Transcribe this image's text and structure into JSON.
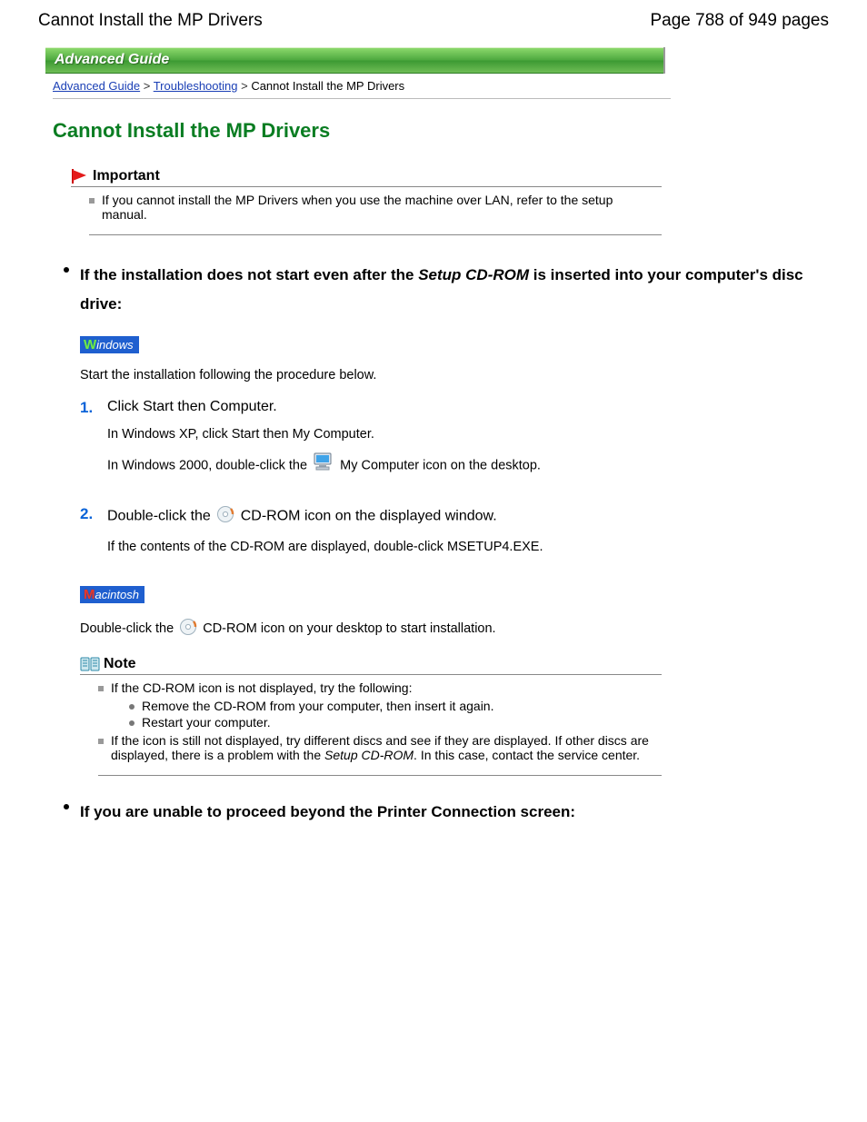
{
  "header": {
    "page_title_top": "Cannot Install the MP Drivers",
    "page_indicator": "Page 788 of 949 pages"
  },
  "banner": {
    "label": "Advanced Guide"
  },
  "breadcrumbs": {
    "link1": "Advanced Guide",
    "link2": "Troubleshooting",
    "current": "Cannot Install the MP Drivers"
  },
  "title": "Cannot Install the MP Drivers",
  "important": {
    "heading": "Important",
    "item1": "If you cannot install the MP Drivers when you use the machine over LAN, refer to the setup manual."
  },
  "section1": {
    "heading_before": "If the installation does not start even after the ",
    "heading_ital": "Setup CD-ROM",
    "heading_after": " is inserted into your computer's disc drive:",
    "windows_label": "indows",
    "intro": "Start the installation following the procedure below.",
    "step1": {
      "title": "Click Start then Computer.",
      "line1": "In Windows XP, click Start then My Computer.",
      "line2_before": "In Windows 2000, double-click the ",
      "line2_after": "My Computer icon on the desktop."
    },
    "step2": {
      "title_before": "Double-click the ",
      "title_after": " CD-ROM icon on the displayed window.",
      "line1": "If the contents of the CD-ROM are displayed, double-click MSETUP4.EXE."
    },
    "mac_label": "acintosh",
    "mac_line_before": "Double-click the ",
    "mac_line_after": " CD-ROM icon on your desktop to start installation."
  },
  "note": {
    "heading": "Note",
    "item1": "If the CD-ROM icon is not displayed, try the following:",
    "sub1": "Remove the CD-ROM from your computer, then insert it again.",
    "sub2": "Restart your computer.",
    "item2_before": "If the icon is still not displayed, try different discs and see if they are displayed. If other discs are displayed, there is a problem with the ",
    "item2_ital": "Setup CD-ROM",
    "item2_after": ". In this case, contact the service center."
  },
  "section2": {
    "heading": "If you are unable to proceed beyond the Printer Connection screen:"
  }
}
